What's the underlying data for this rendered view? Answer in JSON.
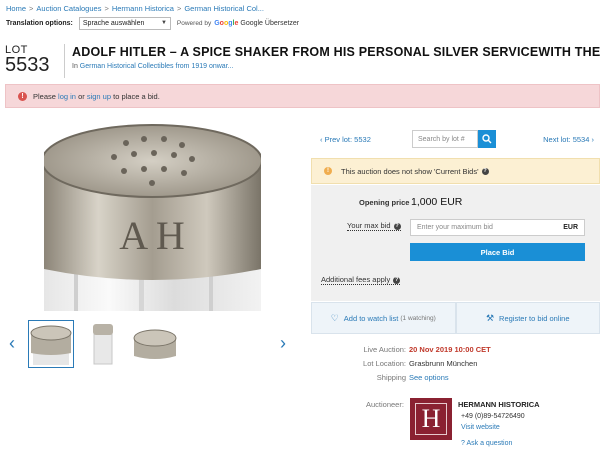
{
  "breadcrumb": {
    "items": [
      "Home",
      "Auction Catalogues",
      "Hermann Historica",
      "German Historical Col..."
    ],
    "separator": ">"
  },
  "translation": {
    "label": "Translation options:",
    "selected": "Sprache auswählen",
    "powered_by": "Powered by",
    "google": "Google",
    "service": "Google Übersetzer"
  },
  "lot": {
    "label": "LOT",
    "number": "5533",
    "title": "ADOLF HITLER – A SPICE SHAKER FROM HIS PERSONAL SILVER SERVICEWITH THE",
    "subtitle_prefix": "In",
    "subtitle_link": "German Historical Collectibles from 1919 onwar..."
  },
  "alert": {
    "icon": "exclamation-icon",
    "text_please": "Please",
    "login": "log in",
    "or": "or",
    "signup": "sign up",
    "text_end": "to place a bid."
  },
  "pager": {
    "prev": "Prev lot: 5532",
    "search_placeholder": "Search by lot #",
    "next": "Next lot: 5534"
  },
  "notice": {
    "text": "This auction does not show 'Current Bids'"
  },
  "bid": {
    "opening_label": "Opening price",
    "opening_value": "1,000 EUR",
    "max_label": "Your max bid",
    "max_placeholder": "Enter your maximum bid",
    "currency": "EUR",
    "place_bid": "Place Bid",
    "fees": "Additional fees apply"
  },
  "actions": {
    "watch": "Add to watch list",
    "watch_count": "(1 watching)",
    "register": "Register to bid online"
  },
  "details": {
    "live_label": "Live Auction:",
    "live_value": "20 Nov 2019 10:00 CET",
    "location_label": "Lot Location:",
    "location_value": "Grasbrunn München",
    "shipping_label": "Shipping",
    "shipping_value": "See options"
  },
  "auctioneer": {
    "label": "Auctioneer:",
    "logo_letter": "H",
    "name": "HERMANN HISTORICA",
    "phone": "+49 (0)89-54726490",
    "website": "Visit website",
    "ask": "Ask a question"
  },
  "image": {
    "engraving": "A H"
  },
  "colors": {
    "accent": "#1a8fd6",
    "link": "#2a7ab7",
    "alert_bg": "#f6d7d9",
    "notice_bg": "#fcf0d3",
    "brand": "#8a2131"
  }
}
